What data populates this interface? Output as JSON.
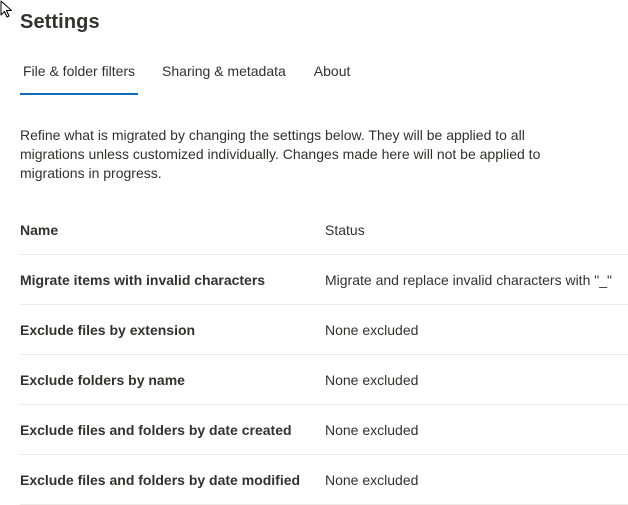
{
  "page": {
    "title": "Settings"
  },
  "tabs": [
    {
      "label": "File & folder filters",
      "active": true
    },
    {
      "label": "Sharing & metadata",
      "active": false
    },
    {
      "label": "About",
      "active": false
    }
  ],
  "description": "Refine what is migrated by changing the settings below. They will be applied to all migrations unless customized individually. Changes made here will not be applied to migrations in progress.",
  "table": {
    "headers": {
      "name": "Name",
      "status": "Status"
    },
    "rows": [
      {
        "name": "Migrate items with invalid characters",
        "status": "Migrate and replace invalid characters with \"_\""
      },
      {
        "name": "Exclude files by extension",
        "status": "None excluded"
      },
      {
        "name": "Exclude folders by name",
        "status": "None excluded"
      },
      {
        "name": "Exclude files and folders by date created",
        "status": "None excluded"
      },
      {
        "name": "Exclude files and folders by date modified",
        "status": "None excluded"
      }
    ]
  },
  "colors": {
    "accent": "#0f6cbd",
    "text": "#323130",
    "divider": "#edebe9"
  },
  "icons": {
    "cursor": "mouse-pointer-icon"
  }
}
